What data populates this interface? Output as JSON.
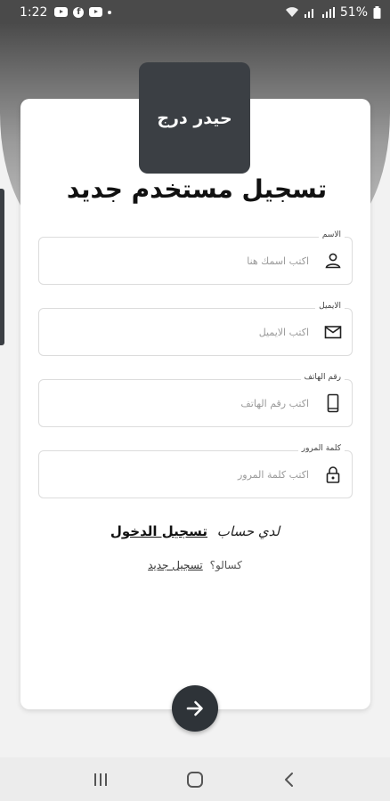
{
  "status_bar": {
    "time": "1:22",
    "battery": "51%",
    "app_icons": [
      "youtube-icon",
      "facebook-icon",
      "youtube-icon"
    ]
  },
  "logo": {
    "text": "حيدر درج"
  },
  "form": {
    "title": "تسجيل مستخدم جديد",
    "fields": [
      {
        "label": "الاسم",
        "placeholder": "اكتب اسمك هنا",
        "icon": "person-icon"
      },
      {
        "label": "الايميل",
        "placeholder": "اكتب الايميل",
        "icon": "mail-icon"
      },
      {
        "label": "رقم الهاتف",
        "placeholder": "اكتب رقم الهاتف",
        "icon": "phone-icon"
      },
      {
        "label": "كلمة المرور",
        "placeholder": "اكتب كلمة المرور",
        "icon": "lock-icon"
      }
    ]
  },
  "links": {
    "have_account": "لدي حساب",
    "login": "تسجيل الدخول",
    "lazy": "كسالو؟",
    "register": "تسجيل جديد"
  },
  "colors": {
    "accent": "#3b3f44",
    "header_top": "#4b4b4b",
    "background": "#f2f2f2"
  },
  "nav": {
    "icons": [
      "recents-icon",
      "home-icon",
      "back-icon"
    ]
  }
}
